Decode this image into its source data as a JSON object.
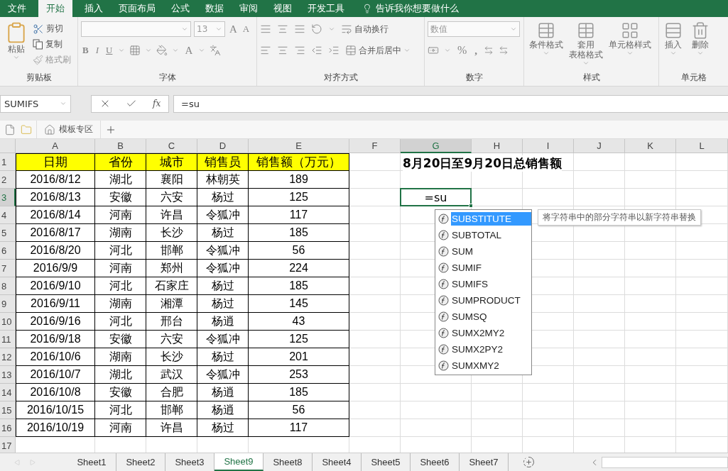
{
  "menu_tabs": [
    {
      "label": "文件",
      "selected": false
    },
    {
      "label": "开始",
      "selected": true
    },
    {
      "label": "插入",
      "selected": false
    },
    {
      "label": "页面布局",
      "selected": false
    },
    {
      "label": "公式",
      "selected": false
    },
    {
      "label": "数据",
      "selected": false
    },
    {
      "label": "审阅",
      "selected": false
    },
    {
      "label": "视图",
      "selected": false
    },
    {
      "label": "开发工具",
      "selected": false
    }
  ],
  "tell_me": "告诉我你想要做什么",
  "ribbon": {
    "clipboard": {
      "title": "剪贴板",
      "paste": "粘贴",
      "cut": "剪切",
      "copy": "复制",
      "format_painter": "格式刷"
    },
    "font": {
      "title": "字体",
      "size": "13",
      "grow": "A",
      "shrink": "A",
      "bold": "B",
      "italic": "I",
      "underline": "U",
      "font_color": "A"
    },
    "alignment": {
      "title": "对齐方式",
      "wrap": "自动换行",
      "merge": "合并后居中"
    },
    "number": {
      "title": "数字",
      "format": "数值",
      "percent": "%",
      "comma": ","
    },
    "styles": {
      "title": "样式",
      "buttons": [
        {
          "lines": [
            "条件格式"
          ]
        },
        {
          "lines": [
            "套用",
            "表格格式"
          ]
        },
        {
          "lines": [
            "单元格样式"
          ]
        }
      ]
    },
    "cells": {
      "title": "单元格",
      "buttons": [
        {
          "lines": [
            "插入"
          ]
        },
        {
          "lines": [
            "删除"
          ]
        }
      ]
    }
  },
  "name_box": "SUMIFS",
  "function_button": "fx",
  "formula": "=su",
  "doc_tabs": {
    "template": "模板专区"
  },
  "columns": [
    {
      "label": "A",
      "selected": false
    },
    {
      "label": "B",
      "selected": false
    },
    {
      "label": "C",
      "selected": false
    },
    {
      "label": "D",
      "selected": false
    },
    {
      "label": "E",
      "selected": false
    },
    {
      "label": "F",
      "selected": false
    },
    {
      "label": "G",
      "selected": true
    },
    {
      "label": "H",
      "selected": false
    },
    {
      "label": "I",
      "selected": false
    },
    {
      "label": "J",
      "selected": false
    },
    {
      "label": "K",
      "selected": false
    },
    {
      "label": "L",
      "selected": false
    }
  ],
  "rows": [
    {
      "number": "1",
      "selected": false,
      "kind": "header",
      "cells": [
        "日期",
        "省份",
        "城市",
        "销售员",
        "销售额（万元）"
      ],
      "title": "8月20日至9月20日总销售额"
    },
    {
      "number": "2",
      "selected": false,
      "kind": "data",
      "cells": [
        "2016/8/12",
        "湖北",
        "襄阳",
        "林朝英",
        "189"
      ]
    },
    {
      "number": "3",
      "selected": true,
      "kind": "data",
      "cells": [
        "2016/8/13",
        "安徽",
        "六安",
        "杨过",
        "125"
      ],
      "editing": "=su"
    },
    {
      "number": "4",
      "selected": false,
      "kind": "data",
      "cells": [
        "2016/8/14",
        "河南",
        "许昌",
        "令狐冲",
        "117"
      ]
    },
    {
      "number": "5",
      "selected": false,
      "kind": "data",
      "cells": [
        "2016/8/17",
        "湖南",
        "长沙",
        "杨过",
        "185"
      ]
    },
    {
      "number": "6",
      "selected": false,
      "kind": "data",
      "cells": [
        "2016/8/20",
        "河北",
        "邯郸",
        "令狐冲",
        "56"
      ]
    },
    {
      "number": "7",
      "selected": false,
      "kind": "data",
      "cells": [
        "2016/9/9",
        "河南",
        "郑州",
        "令狐冲",
        "224"
      ]
    },
    {
      "number": "8",
      "selected": false,
      "kind": "data",
      "cells": [
        "2016/9/10",
        "河北",
        "石家庄",
        "杨过",
        "185"
      ]
    },
    {
      "number": "9",
      "selected": false,
      "kind": "data",
      "cells": [
        "2016/9/11",
        "湖南",
        "湘潭",
        "杨过",
        "145"
      ]
    },
    {
      "number": "10",
      "selected": false,
      "kind": "data",
      "cells": [
        "2016/9/16",
        "河北",
        "邢台",
        "杨逍",
        "43"
      ]
    },
    {
      "number": "11",
      "selected": false,
      "kind": "data",
      "cells": [
        "2016/9/18",
        "安徽",
        "六安",
        "令狐冲",
        "125"
      ]
    },
    {
      "number": "12",
      "selected": false,
      "kind": "data",
      "cells": [
        "2016/10/6",
        "湖南",
        "长沙",
        "杨过",
        "201"
      ]
    },
    {
      "number": "13",
      "selected": false,
      "kind": "data",
      "cells": [
        "2016/10/7",
        "湖北",
        "武汉",
        "令狐冲",
        "253"
      ]
    },
    {
      "number": "14",
      "selected": false,
      "kind": "data",
      "cells": [
        "2016/10/8",
        "安徽",
        "合肥",
        "杨逍",
        "185"
      ]
    },
    {
      "number": "15",
      "selected": false,
      "kind": "data",
      "cells": [
        "2016/10/15",
        "河北",
        "邯郸",
        "杨逍",
        "56"
      ]
    },
    {
      "number": "16",
      "selected": false,
      "kind": "data",
      "cells": [
        "2016/10/19",
        "河南",
        "许昌",
        "杨过",
        "117"
      ]
    },
    {
      "number": "17",
      "selected": false
    }
  ],
  "autocomplete": {
    "items": [
      {
        "label": "SUBSTITUTE",
        "selected": true
      },
      {
        "label": "SUBTOTAL",
        "selected": false
      },
      {
        "label": "SUM",
        "selected": false
      },
      {
        "label": "SUMIF",
        "selected": false
      },
      {
        "label": "SUMIFS",
        "selected": false
      },
      {
        "label": "SUMPRODUCT",
        "selected": false
      },
      {
        "label": "SUMSQ",
        "selected": false
      },
      {
        "label": "SUMX2MY2",
        "selected": false
      },
      {
        "label": "SUMX2PY2",
        "selected": false
      },
      {
        "label": "SUMXMY2",
        "selected": false
      }
    ],
    "tooltip": "将字符串中的部分字符串以新字符串替换"
  },
  "sheets": [
    {
      "label": "Sheet1",
      "selected": false
    },
    {
      "label": "Sheet2",
      "selected": false
    },
    {
      "label": "Sheet3",
      "selected": false
    },
    {
      "label": "Sheet9",
      "selected": true
    },
    {
      "label": "Sheet8",
      "selected": false
    },
    {
      "label": "Sheet4",
      "selected": false
    },
    {
      "label": "Sheet5",
      "selected": false
    },
    {
      "label": "Sheet6",
      "selected": false
    },
    {
      "label": "Sheet7",
      "selected": false
    }
  ]
}
